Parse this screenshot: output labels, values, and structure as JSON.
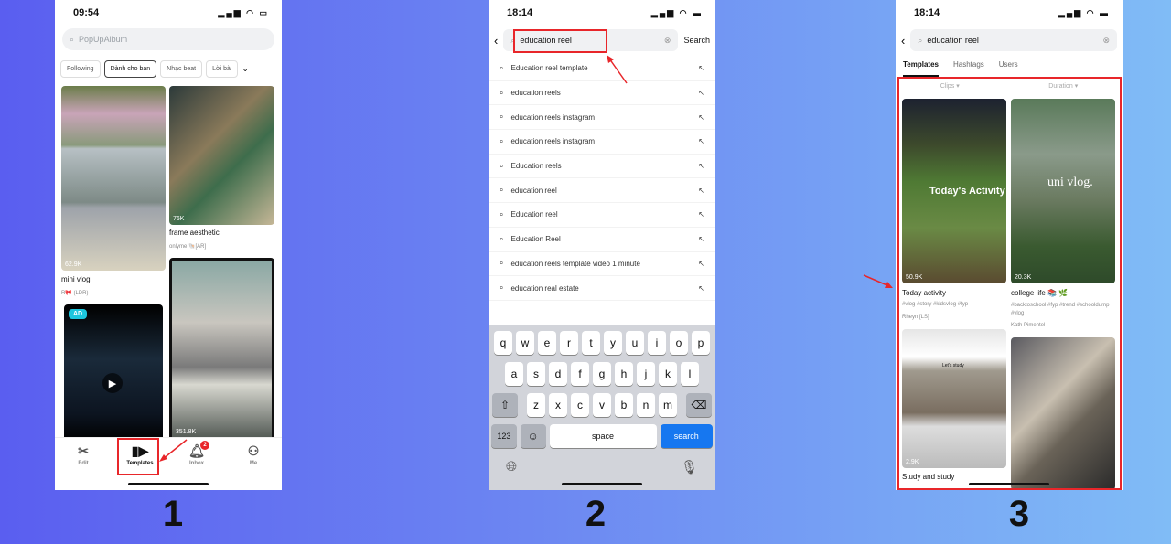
{
  "step_labels": [
    "1",
    "2",
    "3"
  ],
  "phone1": {
    "time": "09:54",
    "search_placeholder": "PopUpAlbum",
    "chips": [
      "Following",
      "Dành cho bạn",
      "Nhạc beat",
      "Lời bài"
    ],
    "cards": [
      {
        "title": "mini vlog",
        "count": "62.9K",
        "author": "R🎀 (LDR)"
      },
      {
        "title": "frame aesthetic",
        "count": "76K",
        "author": "onlyme 🐚[AR]"
      },
      {
        "count": "351.8K"
      }
    ],
    "ad_badge": "AD",
    "nav": [
      {
        "label": "Edit",
        "icon": "scissors-icon"
      },
      {
        "label": "Templates",
        "icon": "templates-icon"
      },
      {
        "label": "Inbox",
        "icon": "bell-icon",
        "badge": "2"
      },
      {
        "label": "Me",
        "icon": "person-icon"
      }
    ]
  },
  "phone2": {
    "time": "18:14",
    "search_value": "education reel",
    "search_button": "Search",
    "suggestions": [
      "Education reel template",
      "education reels",
      "education reels instagram",
      "education reels instagram",
      "Education reels",
      "education reel",
      "Education reel",
      "Education Reel",
      "education reels template video 1 minute",
      "education real estate"
    ],
    "keyboard": {
      "row1": [
        "q",
        "w",
        "e",
        "r",
        "t",
        "y",
        "u",
        "i",
        "o",
        "p"
      ],
      "row2": [
        "a",
        "s",
        "d",
        "f",
        "g",
        "h",
        "j",
        "k",
        "l"
      ],
      "row3": [
        "z",
        "x",
        "c",
        "v",
        "b",
        "n",
        "m"
      ],
      "num": "123",
      "space": "space",
      "search": "search"
    }
  },
  "phone3": {
    "time": "18:14",
    "search_value": "education reel",
    "tabs": [
      "Templates",
      "Hashtags",
      "Users"
    ],
    "filters": [
      "Clips",
      "Duration"
    ],
    "cards": [
      {
        "title": "Today activity",
        "tags": "#vlog #story #kidsvlog #fyp",
        "author": "Rheyn [LS]",
        "count": "50.9K",
        "overlay": "Today's Activity"
      },
      {
        "title": "college life 📚 🌿",
        "tags": "#backtoschool #fyp #trend #schooldump #vlog",
        "author": "Kath Pimentel",
        "count": "20.3K",
        "overlay": "uni vlog."
      },
      {
        "title": "Study and study",
        "count": "2.9K",
        "overlay": "Let's study"
      }
    ]
  },
  "colors": {
    "highlight": "#e8262a",
    "accent_blue": "#1677f0"
  }
}
